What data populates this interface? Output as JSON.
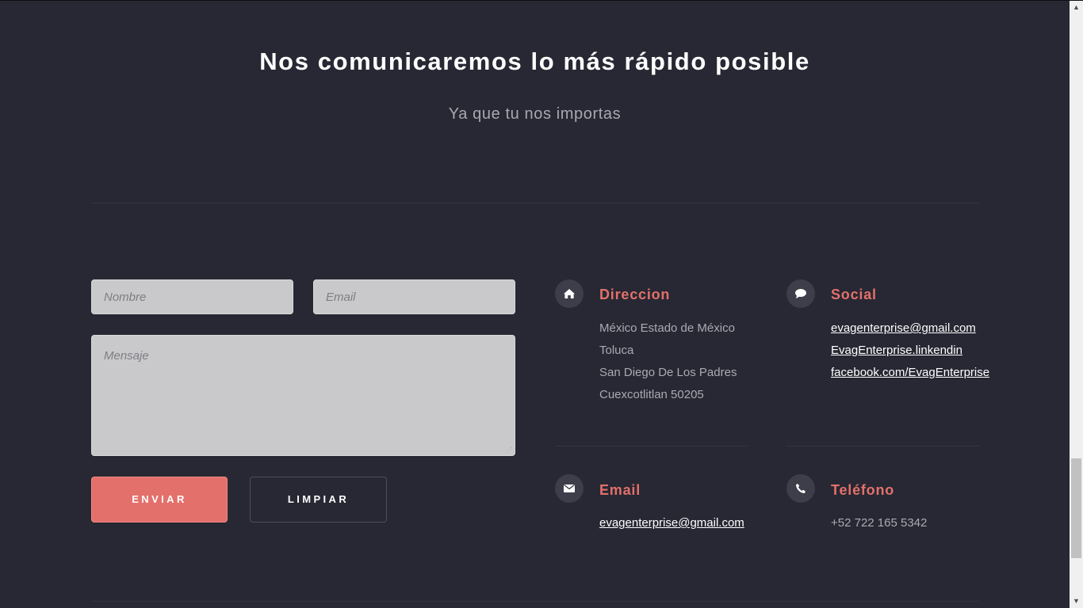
{
  "section": {
    "title": "Nos comunicaremos lo más rápido posible",
    "subtitle": "Ya que tu nos importas"
  },
  "form": {
    "name_placeholder": "Nombre",
    "email_placeholder": "Email",
    "message_placeholder": "Mensaje",
    "submit_label": "ENVIAR",
    "clear_label": "LIMPIAR"
  },
  "contact": {
    "address": {
      "icon": "home-icon",
      "title": "Direccion",
      "lines": [
        "México Estado de México",
        "Toluca",
        "San Diego De Los Padres",
        "Cuexcotlitlan 50205"
      ]
    },
    "social": {
      "icon": "chat-bubble-icon",
      "title": "Social",
      "links": [
        "evagenterprise@gmail.com",
        "EvagEnterprise.linkendin",
        "facebook.com/EvagEnterprise"
      ]
    },
    "email": {
      "icon": "envelope-icon",
      "title": "Email",
      "value": "evagenterprise@gmail.com"
    },
    "phone": {
      "icon": "phone-icon",
      "title": "Teléfono",
      "value": "+52 722 165 5342"
    }
  },
  "colors": {
    "background": "#272833",
    "accent": "#e3706b",
    "field": "#c9c9cb",
    "icon_circle": "#3d3e4a"
  }
}
